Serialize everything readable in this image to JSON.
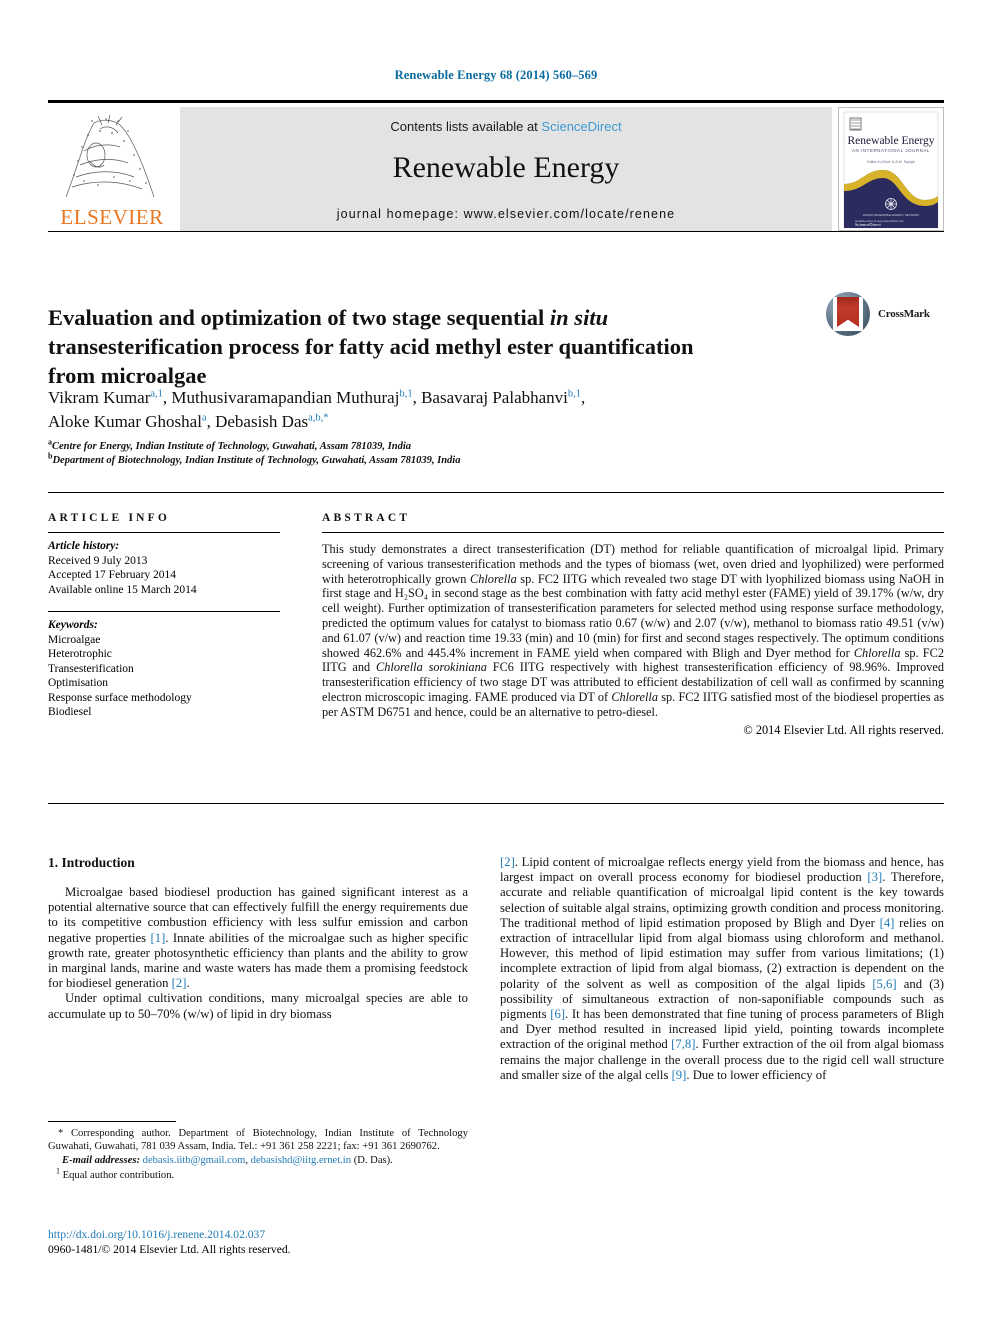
{
  "running_head": "Renewable Energy 68 (2014) 560–569",
  "masthead": {
    "publisher_logo_text": "ELSEVIER",
    "contents_prefix": "Contents lists available at ",
    "contents_link": "ScienceDirect",
    "journal_name": "Renewable Energy",
    "homepage": "journal homepage: www.elsevier.com/locate/renene",
    "cover": {
      "title": "Renewable Energy",
      "subtitle": "AN INTERNATIONAL JOURNAL",
      "editor_line": "Editor-in-Chief: A.A.M. Sayigh",
      "footer": "ELSEVIER"
    }
  },
  "article": {
    "title_line1": "Evaluation and optimization of two stage sequential ",
    "title_italic": "in situ",
    "title_line2": "transesterification process for fatty acid methyl ester quantification",
    "title_line3": "from microalgae",
    "crossmark_label": "CrossMark",
    "authors": [
      {
        "name": "Vikram Kumar",
        "sup": "a,1",
        "sep": ", "
      },
      {
        "name": "Muthusivaramapandian Muthuraj",
        "sup": "b,1",
        "sep": ", "
      },
      {
        "name": "Basavaraj Palabhanvi",
        "sup": "b,1",
        "sep": ","
      },
      {
        "name": "Aloke Kumar Ghoshal",
        "sup": "a",
        "sep": ", "
      },
      {
        "name": "Debasish Das",
        "sup": "a,b,*",
        "sep": ""
      }
    ],
    "affiliations": [
      {
        "marker": "a",
        "text": "Centre for Energy, Indian Institute of Technology, Guwahati, Assam 781039, India"
      },
      {
        "marker": "b",
        "text": "Department of Biotechnology, Indian Institute of Technology, Guwahati, Assam 781039, India"
      }
    ]
  },
  "article_info": {
    "heading": "ARTICLE INFO",
    "history_label": "Article history:",
    "history": [
      "Received 9 July 2013",
      "Accepted 17 February 2014",
      "Available online 15 March 2014"
    ],
    "keywords_label": "Keywords:",
    "keywords": [
      "Microalgae",
      "Heterotrophic",
      "Transesterification",
      "Optimisation",
      "Response surface methodology",
      "Biodiesel"
    ]
  },
  "abstract": {
    "heading": "ABSTRACT",
    "part1": "This study demonstrates a direct transesterification (DT) method for reliable quantification of microalgal lipid. Primary screening of various transesterification methods and the types of biomass (wet, oven dried and lyophilized) were performed with heterotrophically grown ",
    "italic1": "Chlorella",
    "part2": " sp. FC2 IITG which revealed two stage DT with lyophilized biomass using NaOH in first stage and H₂SO₄ in second stage as the best combination with fatty acid methyl ester (FAME) yield of 39.17% (w/w, dry cell weight). Further optimization of transesterification parameters for selected method using response surface methodology, predicted the optimum values for catalyst to biomass ratio 0.67 (w/w) and 2.07 (v/w), methanol to biomass ratio 49.51 (v/w) and 61.07 (v/w) and reaction time 19.33 (min) and 10 (min) for first and second stages respectively. The optimum conditions showed 462.6% and 445.4% increment in FAME yield when compared with Bligh and Dyer method for ",
    "italic2": "Chlorella",
    "part3": " sp. FC2 IITG and ",
    "italic3": "Chlorella sorokiniana",
    "part4": " FC6 IITG respectively with highest transesterification efficiency of 98.96%. Improved transesterification efficiency of two stage DT was attributed to efficient destabilization of cell wall as confirmed by scanning electron microscopic imaging. FAME produced via DT of ",
    "italic4": "Chlorella",
    "part5": " sp. FC2 IITG satisfied most of the biodiesel properties as per ASTM D6751 and hence, could be an alternative to petro-diesel.",
    "copyright": "© 2014 Elsevier Ltd. All rights reserved."
  },
  "body": {
    "section_number_title": "1. Introduction",
    "left_p1_a": "Microalgae based biodiesel production has gained significant interest as a potential alternative source that can effectively fulfill the energy requirements due to its competitive combustion efficiency with less sulfur emission and carbon negative properties ",
    "left_p1_ref1": "[1]",
    "left_p1_b": ". Innate abilities of the microalgae such as higher specific growth rate, greater photosynthetic efficiency than plants and the ability to grow in marginal lands, marine and waste waters has made them a promising feedstock for biodiesel generation ",
    "left_p1_ref2": "[2]",
    "left_p1_c": ".",
    "left_p2_a": "Under optimal cultivation conditions, many microalgal species are able to accumulate up to 50–70% (w/w) of lipid in dry biomass",
    "right_p1_ref1": "[2]",
    "right_p1_a": ". Lipid content of microalgae reflects energy yield from the biomass and hence, has largest impact on overall process economy for biodiesel production ",
    "right_p1_ref2": "[3]",
    "right_p1_b": ". Therefore, accurate and reliable quantification of microalgal lipid content is the key towards selection of suitable algal strains, optimizing growth condition and process monitoring. The traditional method of lipid estimation proposed by Bligh and Dyer ",
    "right_p1_ref3": "[4]",
    "right_p1_c": " relies on extraction of intracellular lipid from algal biomass using chloroform and methanol. However, this method of lipid estimation may suffer from various limitations; (1) incomplete extraction of lipid from algal biomass, (2) extraction is dependent on the polarity of the solvent as well as composition of the algal lipids ",
    "right_p1_ref4": "[5,6]",
    "right_p1_d": " and (3) possibility of simultaneous extraction of non-saponifiable compounds such as pigments ",
    "right_p1_ref5": "[6]",
    "right_p1_e": ". It has been demonstrated that fine tuning of process parameters of Bligh and Dyer method resulted in increased lipid yield, pointing towards incomplete extraction of the original method ",
    "right_p1_ref6": "[7,8]",
    "right_p1_f": ". Further extraction of the oil from algal biomass remains the major challenge in the overall process due to the rigid cell wall structure and smaller size of the algal cells ",
    "right_p1_ref7": "[9]",
    "right_p1_g": ". Due to lower efficiency of"
  },
  "footnotes": {
    "corresponding": "* Corresponding author. Department of Biotechnology, Indian Institute of Technology Guwahati, Guwahati, 781 039 Assam, India. Tel.: +91 361 258 2221; fax: +91 361 2690762.",
    "email_label": "E-mail addresses:",
    "email1": "debasis.iitb@gmail.com",
    "email_sep": ", ",
    "email2": "debasishd@iitg.ernet.in",
    "email_suffix": " (D. Das).",
    "equal_marker": "1",
    "equal_contribution": "Equal author contribution."
  },
  "doi_block": {
    "doi": "http://dx.doi.org/10.1016/j.renene.2014.02.037",
    "issn_line": "0960-1481/© 2014 Elsevier Ltd. All rights reserved."
  },
  "colors": {
    "link": "#1f7bb6",
    "sciencedirect": "#3e9bd1",
    "elsevier_orange": "#e87722",
    "running_head": "#0b6ba0",
    "masthead_bg": "#e3e3e3"
  }
}
